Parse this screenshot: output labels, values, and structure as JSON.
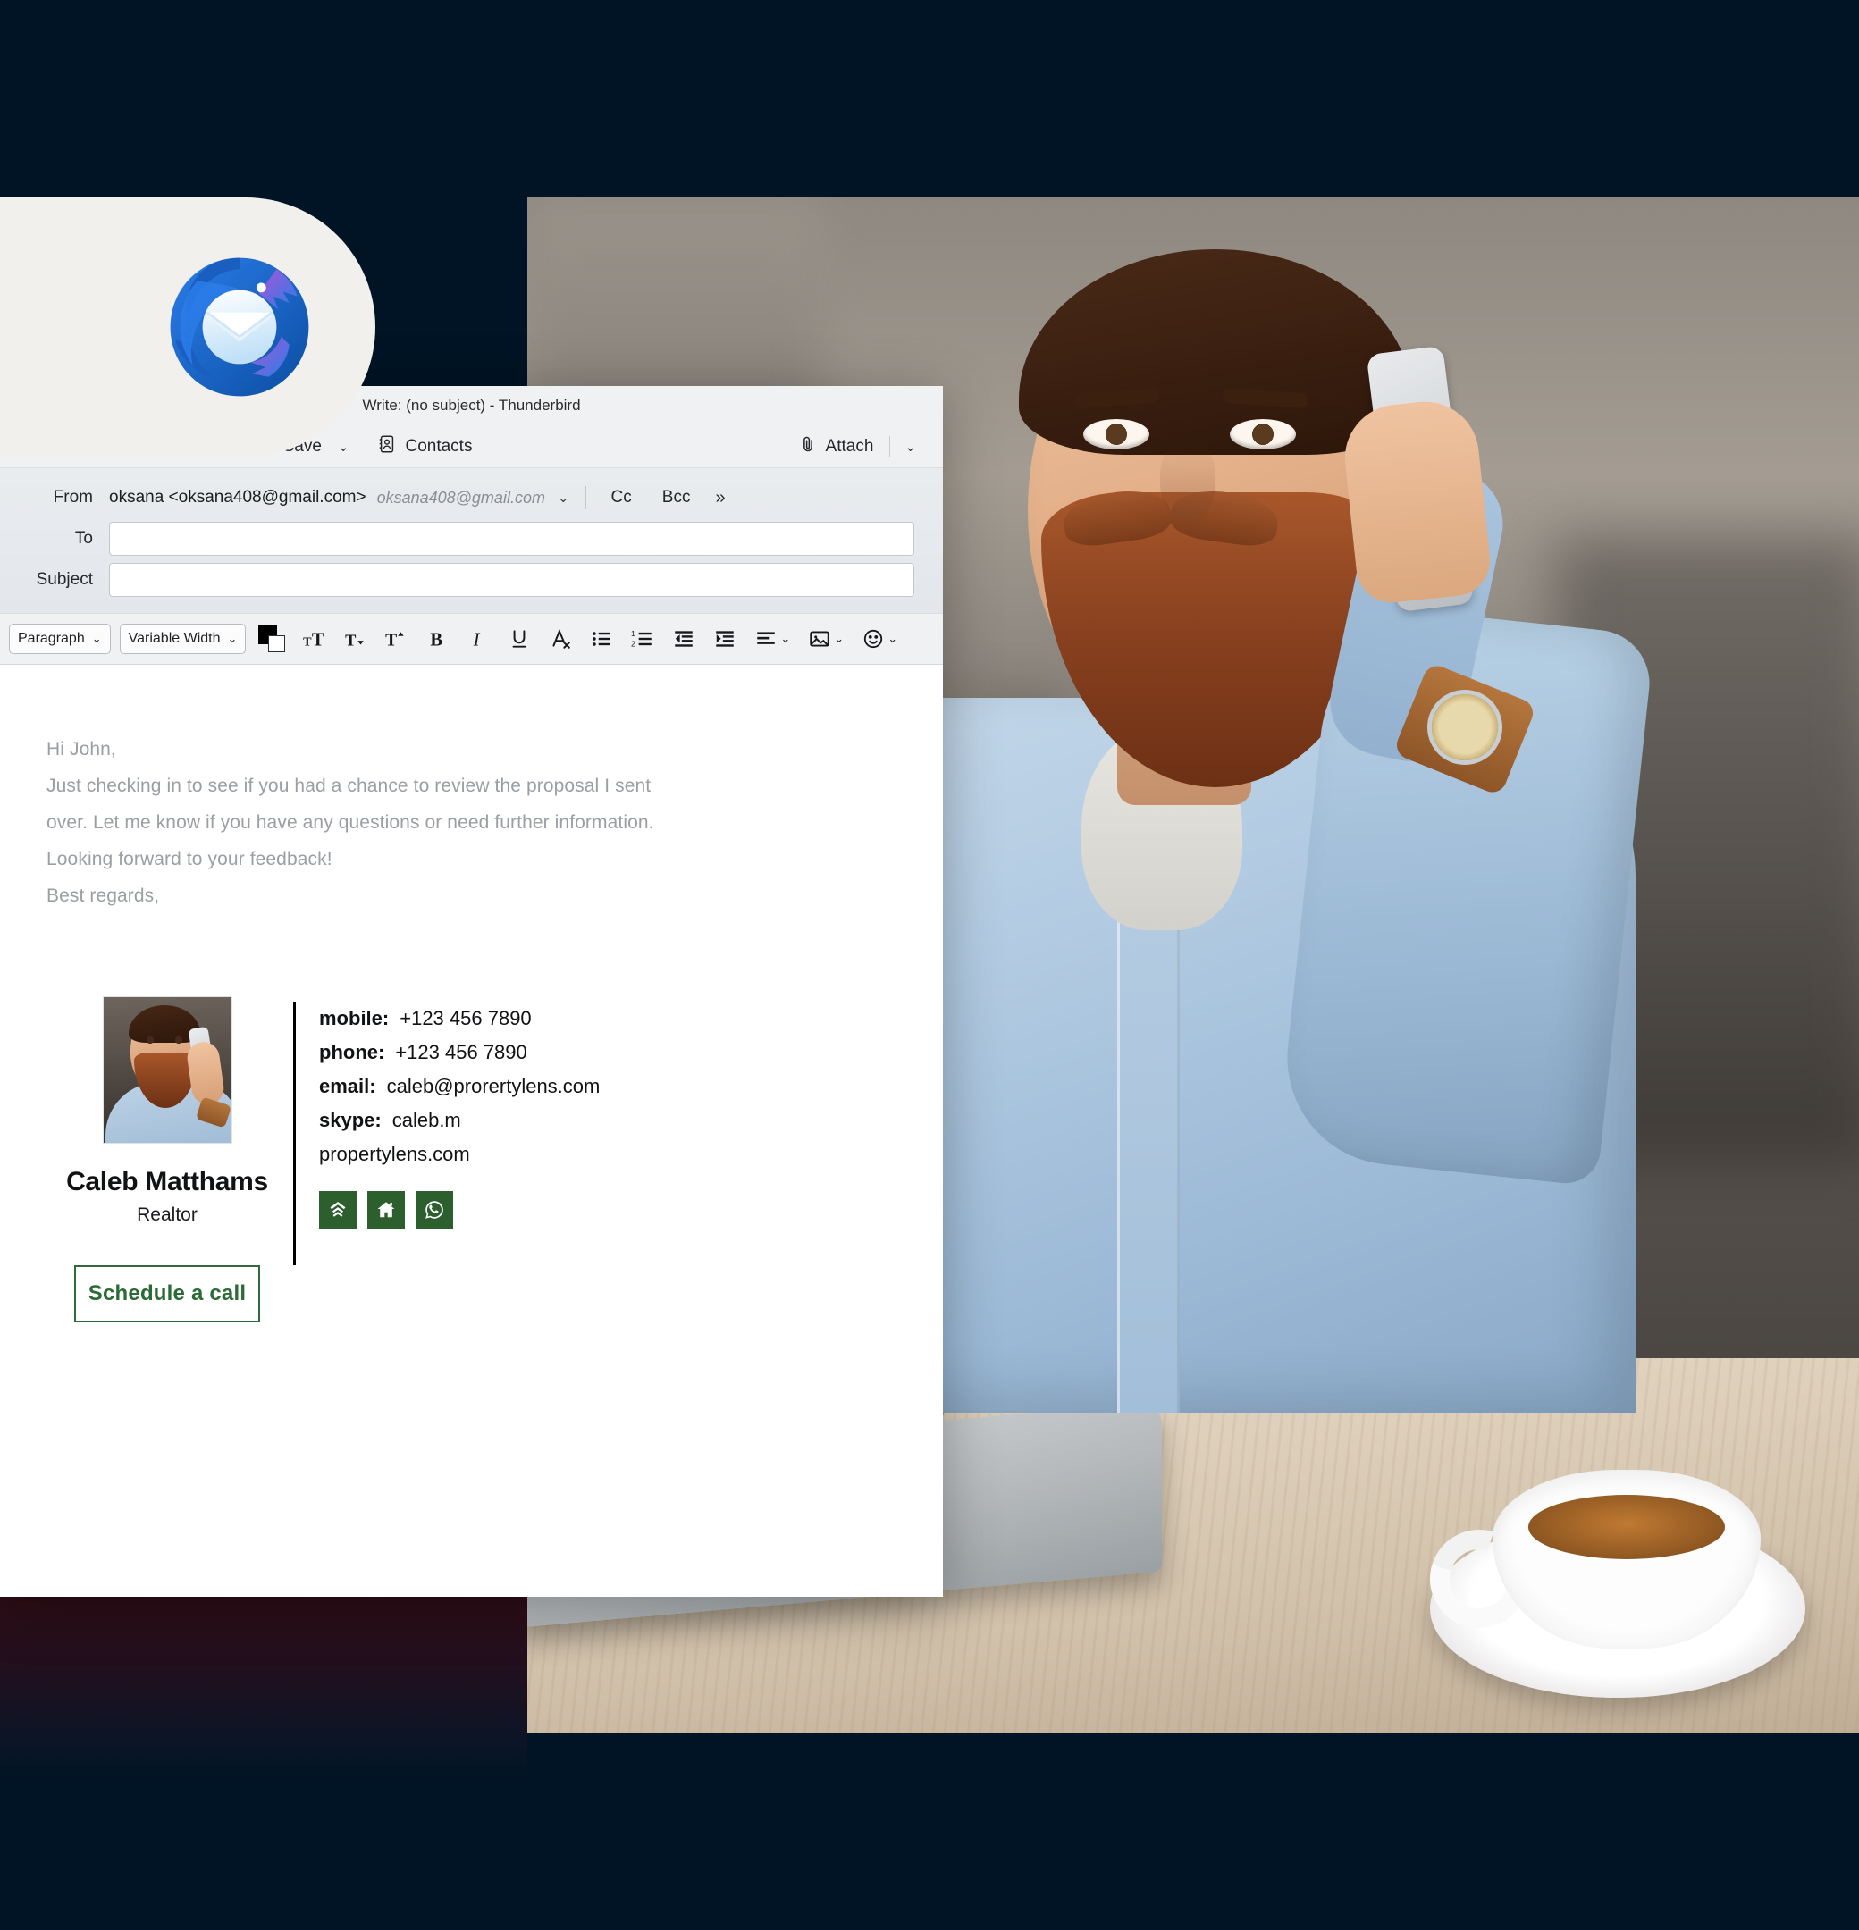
{
  "background": {
    "page_color": "#011425",
    "accent_maroon": "#2e0d16"
  },
  "brand": {
    "logo_name": "thunderbird-logo",
    "app_name": "Thunderbird"
  },
  "window": {
    "title": "Write: (no subject) - Thunderbird",
    "toolbar": {
      "send_chevron": "⌄",
      "save_label": "Save",
      "save_chevron": "⌄",
      "contacts_label": "Contacts",
      "attach_label": "Attach",
      "attach_chevron": "⌄"
    },
    "headers": {
      "from_label": "From",
      "from_value": "oksana <oksana408@gmail.com>",
      "from_alias": "oksana408@gmail.com",
      "from_chevron": "⌄",
      "cc_label": "Cc",
      "bcc_label": "Bcc",
      "more_label": "»",
      "to_label": "To",
      "to_value": "",
      "subject_label": "Subject",
      "subject_value": ""
    },
    "format_bar": {
      "paragraph_label": "Paragraph",
      "paragraph_chevron": "⌄",
      "font_label": "Variable Width",
      "font_chevron": "⌄",
      "color_swatch_fg": "#000000",
      "color_swatch_bg": "#ffffff",
      "buttons": [
        "increase-font-size-icon",
        "decrease-font-size-icon",
        "superscript-icon",
        "bold-icon",
        "italic-icon",
        "underline-icon",
        "remove-formatting-icon",
        "bullet-list-icon",
        "numbered-list-icon",
        "outdent-icon",
        "indent-icon",
        "align-icon",
        "insert-image-icon",
        "insert-emoji-icon"
      ]
    }
  },
  "mail": {
    "body_lines": [
      "Hi John,",
      "Just checking in to see if you had a chance to review the proposal I sent",
      "over. Let me know if you have any questions or need further information.",
      "Looking forward to your feedback!",
      "Best regards,"
    ]
  },
  "signature": {
    "avatar_name": "signature-avatar-photo",
    "name": "Caleb Matthams",
    "role": "Realtor",
    "cta_label": "Schedule a call",
    "cta_color": "#2b6b35",
    "contact": [
      {
        "label": "mobile:",
        "value": "+123 456 7890"
      },
      {
        "label": "phone:",
        "value": "+123 456 7890"
      },
      {
        "label": "email:",
        "value": "caleb@prorertylens.com"
      },
      {
        "label": "skype:",
        "value": "caleb.m"
      }
    ],
    "website": "propertylens.com",
    "social_color": "#2c5f2d",
    "social": [
      "zillow-icon",
      "house-icon",
      "whatsapp-icon"
    ]
  }
}
